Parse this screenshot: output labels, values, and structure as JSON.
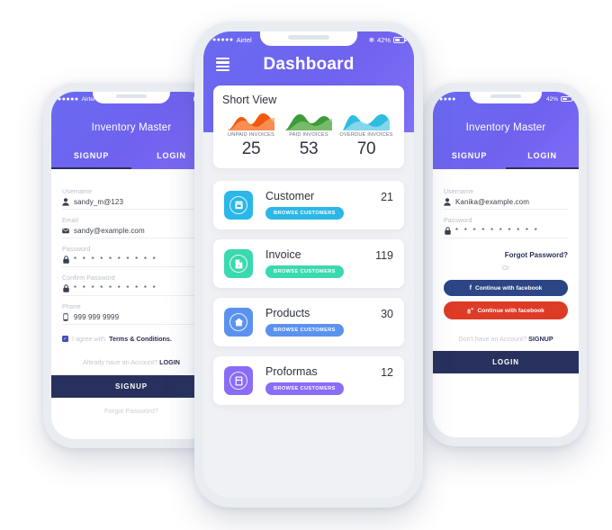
{
  "app": {
    "brand": "Inventory Master"
  },
  "left_phone": {
    "status": {
      "dots": "●●●●●",
      "carrier": "Airtel",
      "battery": ""
    },
    "title": "Inventory Master",
    "tabs": [
      {
        "label": "SIGNUP",
        "active": true
      },
      {
        "label": "LOGIN",
        "active": false
      }
    ],
    "fields": [
      {
        "label": "Username",
        "value": "sandy_m@123",
        "icon": "user-icon"
      },
      {
        "label": "Email",
        "value": "sandy@example.com",
        "icon": "envelope-icon"
      },
      {
        "label": "Password",
        "value": "* * * * * * * * * *",
        "icon": "lock-icon"
      },
      {
        "label": "Confirm Password",
        "value": "* * * * * * * * * *",
        "icon": "lock-icon"
      },
      {
        "label": "Phone",
        "value": "999 999 9999",
        "icon": "phone-icon"
      }
    ],
    "terms": {
      "checked": true,
      "prefix": "I agree with ",
      "link": "Terms & Conditions."
    },
    "switch_prompt": "Alteady have an Account? ",
    "switch_link": "LOGIN",
    "primary_button": "SIGNUP",
    "forgot": "Forgot Password?"
  },
  "center_phone": {
    "status": {
      "dots": "●●●●●",
      "carrier": "Airtel",
      "bluetooth": "✻",
      "battery_pct": "42%"
    },
    "title": "Dashboard",
    "menu_icon": "hamburger-menu-icon",
    "short_view": {
      "title": "Short View",
      "stats": [
        {
          "label": "UNPAID INVOICES",
          "value": "25",
          "color": "#f15a0e"
        },
        {
          "label": "PAID INVOICES",
          "value": "53",
          "color": "#3e9b3a"
        },
        {
          "label": "OVERDUE INVOICES",
          "value": "70",
          "color": "#30bce0"
        }
      ]
    },
    "items": [
      {
        "name": "Customer",
        "count": "21",
        "button": "BROWSE CUSTOMERS",
        "color": "#2bb7e8",
        "icon": "store-icon"
      },
      {
        "name": "Invoice",
        "count": "119",
        "button": "BROWSE CUSTOMERS",
        "color": "#3ad9b0",
        "icon": "file-pdf-icon"
      },
      {
        "name": "Products",
        "count": "30",
        "button": "BROWSE CUSTOMERS",
        "color": "#5b92f0",
        "icon": "home-icon"
      },
      {
        "name": "Proformas",
        "count": "12",
        "button": "BROWSE CUSTOMERS",
        "color": "#8a6cf6",
        "icon": "calculator-icon"
      }
    ]
  },
  "right_phone": {
    "status": {
      "dots": "●●●●",
      "carrier": "",
      "battery_pct": "42%"
    },
    "title": "Inventory Master",
    "tabs": [
      {
        "label": "SIGNUP",
        "active": false
      },
      {
        "label": "LOGIN",
        "active": true
      }
    ],
    "fields": [
      {
        "label": "Username",
        "value": "Kanika@example.com",
        "icon": "user-icon"
      },
      {
        "label": "Password",
        "value": "* * * * * * * * * *",
        "icon": "lock-icon"
      }
    ],
    "forgot_password": "Forgot Password?",
    "or": "Or",
    "social": [
      {
        "label": "Continue with facebook",
        "icon": "facebook-icon",
        "color": "#2c4585"
      },
      {
        "label": "Continue with facebook",
        "icon": "google-plus-icon",
        "color": "#de3b26"
      }
    ],
    "switch_prompt": "Don't have an Account? ",
    "switch_link": "SIGNUP",
    "primary_button": "LOGIN"
  },
  "theme": {
    "header_purple": "#6f63ef",
    "dark_navy": "#28315e",
    "page_bg": "#f0f1f5"
  }
}
